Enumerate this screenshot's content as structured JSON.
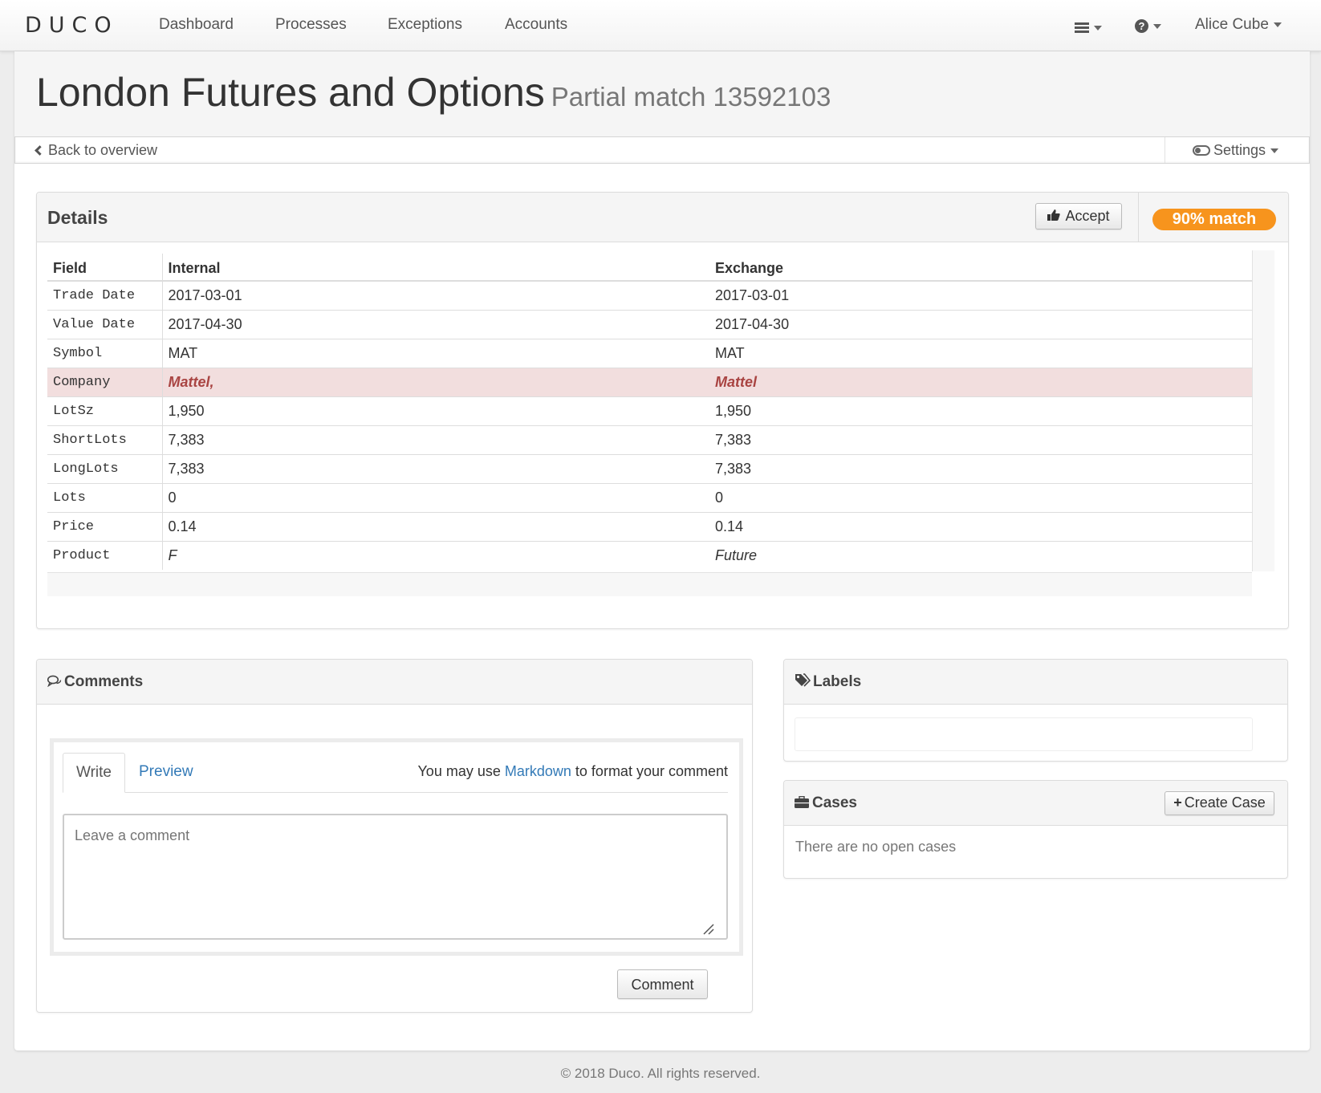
{
  "nav": {
    "brand": "DUCO",
    "links": [
      "Dashboard",
      "Processes",
      "Exceptions",
      "Accounts"
    ],
    "user": "Alice Cube"
  },
  "header": {
    "title": "London Futures and Options",
    "subtitle": "Partial match 13592103"
  },
  "subbar": {
    "back": "Back to overview",
    "settings": "Settings"
  },
  "details": {
    "title": "Details",
    "accept_label": "Accept",
    "match_badge": "90% match",
    "columns": [
      "Field",
      "Internal",
      "Exchange"
    ],
    "rows": [
      {
        "field": "Trade Date",
        "internal": "2017-03-01",
        "exchange": "2017-03-01"
      },
      {
        "field": "Value Date",
        "internal": "2017-04-30",
        "exchange": "2017-04-30"
      },
      {
        "field": "Symbol",
        "internal": "MAT",
        "exchange": "MAT"
      },
      {
        "field": "Company",
        "internal": "Mattel,",
        "exchange": "Mattel"
      },
      {
        "field": "LotSz",
        "internal": "1,950",
        "exchange": "1,950"
      },
      {
        "field": "ShortLots",
        "internal": "7,383",
        "exchange": "7,383"
      },
      {
        "field": "LongLots",
        "internal": "7,383",
        "exchange": "7,383"
      },
      {
        "field": "Lots",
        "internal": "0",
        "exchange": "0"
      },
      {
        "field": "Price",
        "internal": "0.14",
        "exchange": "0.14"
      },
      {
        "field": "Product",
        "internal": "F",
        "exchange": "Future"
      }
    ]
  },
  "comments": {
    "title": "Comments",
    "tab_write": "Write",
    "tab_preview": "Preview",
    "hint_prefix": "You may use",
    "hint_link": "Markdown",
    "hint_suffix": "to format your comment",
    "placeholder": "Leave a comment",
    "submit_label": "Comment"
  },
  "labels": {
    "title": "Labels"
  },
  "cases": {
    "title": "Cases",
    "create_label": "Create Case",
    "empty_text": "There are no open cases"
  },
  "footer": {
    "text": "© 2018 Duco. All rights reserved."
  },
  "colors": {
    "accent": "#f7941d",
    "mismatch_bg": "#f2dede",
    "mismatch_text": "#a94442",
    "link": "#337ab7"
  }
}
